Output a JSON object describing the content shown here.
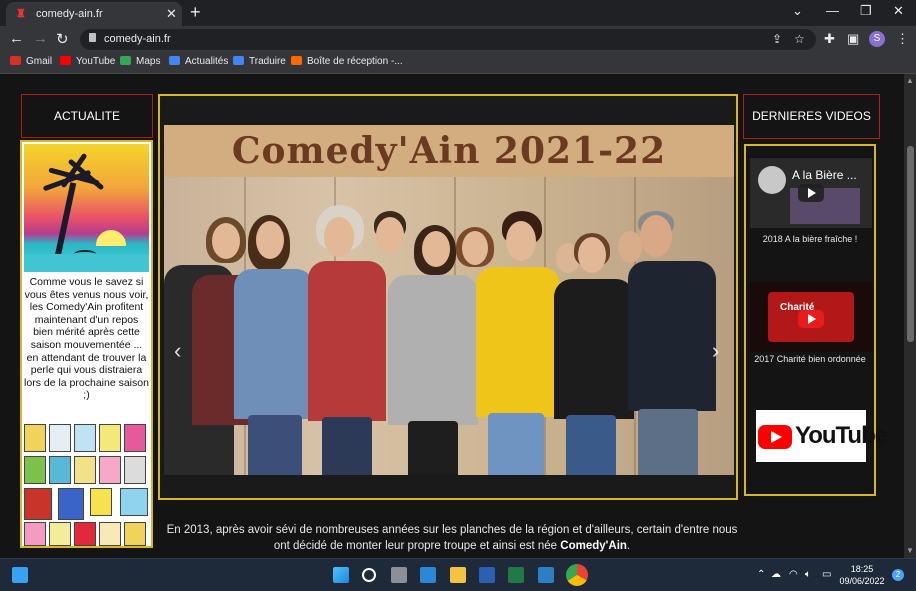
{
  "browser": {
    "tab_title": "comedy-ain.fr",
    "url": "comedy-ain.fr",
    "avatar_letter": "S",
    "bookmarks": [
      {
        "label": "Gmail",
        "color": "#d93025"
      },
      {
        "label": "YouTube",
        "color": "#ff0000"
      },
      {
        "label": "Maps",
        "color": "#34a853"
      },
      {
        "label": "Actualités",
        "color": "#4285f4"
      },
      {
        "label": "Traduire",
        "color": "#4285f4"
      },
      {
        "label": "Boîte de réception -...",
        "color": "#ff6a00"
      }
    ]
  },
  "page": {
    "left": {
      "heading": "ACTUALITE",
      "text": "Comme vous le savez si vous êtes venus nous voir, les Comedy'Ain profitent maintenant d'un repos bien mérité après cette saison mouvementée ... en attendant de trouver la perle qui vous distraiera lors de la prochaine saison ;)"
    },
    "slideshow": {
      "title": "Comedy'Ain 2021-22",
      "prev_glyph": "‹",
      "next_glyph": "›"
    },
    "right": {
      "heading": "DERNIERES VIDEOS",
      "videos": [
        {
          "label": "2018 A la bière fraîche !",
          "thumb_title": "A la Bière ..."
        },
        {
          "label": "2017 Charité bien ordonnée",
          "thumb_title": "Charité"
        }
      ],
      "youtube_text": "YouTube"
    },
    "intro": {
      "text": "En 2013, après avoir sévi de nombreuses années sur les planches de la région et d'ailleurs, certain d'entre nous ont décidé de monter leur propre troupe et ainsi est née",
      "brand": "Comedy'Ain",
      "end": "."
    }
  },
  "taskbar": {
    "time": "18:25",
    "date": "09/06/2022",
    "notifications": "2"
  },
  "colors": {
    "gold_border": "#d6b62a",
    "red_border": "#b01d1d",
    "title_brown": "#6b3a20"
  }
}
